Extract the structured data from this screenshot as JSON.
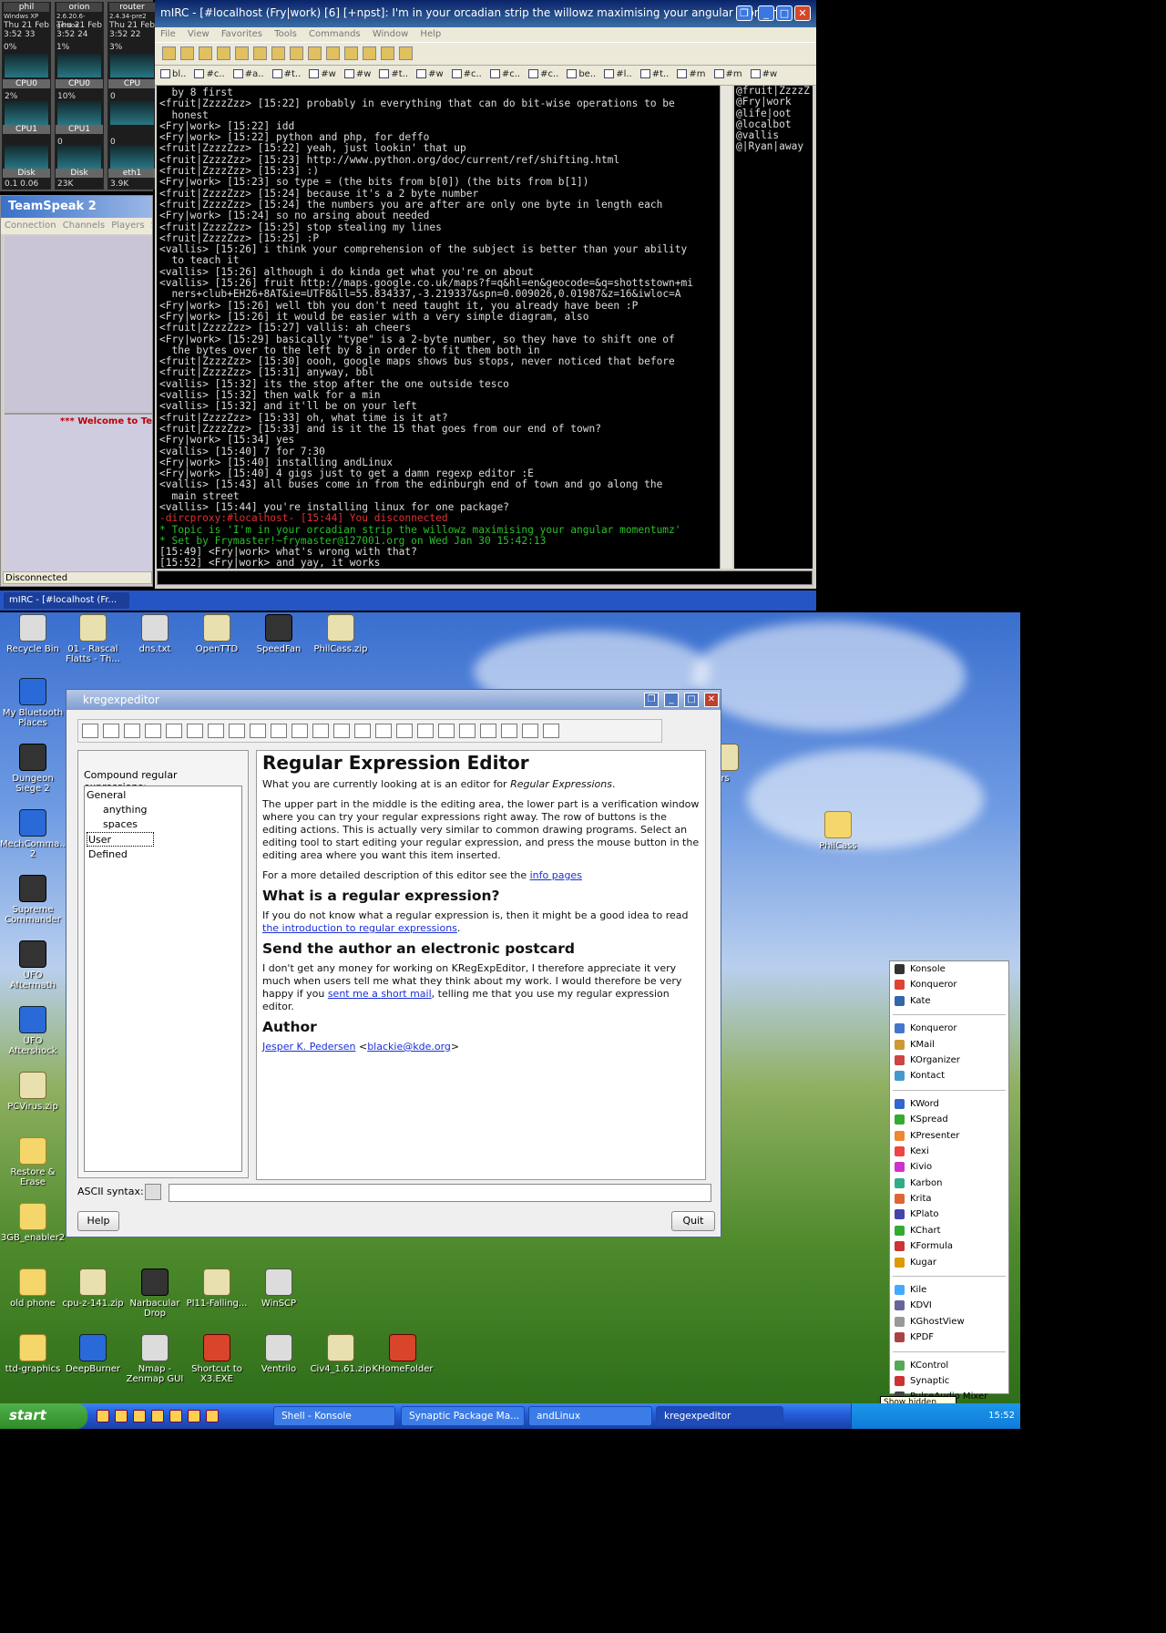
{
  "monitors": {
    "top": [
      {
        "host": "phil",
        "os": "Windws XP",
        "date": "Thu 21 Feb",
        "time": "3:52 33",
        "cpu_pct": "0%",
        "cpu_label": "CPU0",
        "cpu_pct2": "2%",
        "cpu1_label": "CPU1",
        "disk_label": "Disk",
        "disk_val": "0.1 0.06"
      },
      {
        "host": "orion",
        "os": "2.6.20.6-gentoo",
        "date": "Thu 21 Feb",
        "time": "3:52 24",
        "cpu_pct": "1%",
        "cpu_label": "CPU0",
        "cpu_pct2": "10%",
        "cpu1_label": "CPU1",
        "cpu1_val": "0",
        "disk_label": "Disk",
        "disk_val": "23K"
      },
      {
        "host": "router",
        "os": "2.4.34-pre2",
        "date": "Thu 21 Feb",
        "time": "3:52 22",
        "cpu_pct": "3%",
        "cpu_label": "CPU",
        "cpu_pct2": "0",
        "cpu1_label": "",
        "cpu1_val": "0",
        "disk_label": "eth1",
        "disk_val": "3.9K"
      }
    ]
  },
  "teamspeak": {
    "title": "TeamSpeak 2",
    "menu": [
      "Connection",
      "Channels",
      "Players",
      "Se"
    ],
    "welcome": "*** Welcome to Te",
    "status": "Disconnected"
  },
  "mirc": {
    "title": "mIRC - [#localhost (Fry|work) [6] [+npst]: I'm in your orcadian strip the willowz maximising your angular moment",
    "menu": [
      "File",
      "View",
      "Favorites",
      "Tools",
      "Commands",
      "Window",
      "Help"
    ],
    "tabs": [
      "bl..",
      "#c..",
      "#a..",
      "#t..",
      "#w",
      "#w",
      "#t..",
      "#w",
      "#c..",
      "#c..",
      "#c..",
      "be..",
      "#l..",
      "#t..",
      "#m",
      "#m",
      "#w"
    ],
    "chat": [
      {
        "t": "  by 8 first",
        "c": ""
      },
      {
        "t": "<fruit|ZzzzZzz> [15:22] probably in everything that can do bit-wise operations to be\n  honest",
        "c": ""
      },
      {
        "t": "<Fry|work> [15:22] idd",
        "c": ""
      },
      {
        "t": "<Fry|work> [15:22] python and php, for deffo",
        "c": ""
      },
      {
        "t": "<fruit|ZzzzZzz> [15:22] yeah, just lookin' that up",
        "c": ""
      },
      {
        "t": "<fruit|ZzzzZzz> [15:23] http://www.python.org/doc/current/ref/shifting.html",
        "c": ""
      },
      {
        "t": "<fruit|ZzzzZzz> [15:23] :)",
        "c": ""
      },
      {
        "t": "<Fry|work> [15:23] so type = (the bits from b[0]) (the bits from b[1])",
        "c": ""
      },
      {
        "t": "<fruit|ZzzzZzz> [15:24] because it's a 2 byte number",
        "c": ""
      },
      {
        "t": "<fruit|ZzzzZzz> [15:24] the numbers you are after are only one byte in length each",
        "c": ""
      },
      {
        "t": "<Fry|work> [15:24] so no arsing about needed",
        "c": ""
      },
      {
        "t": "<fruit|ZzzzZzz> [15:25] stop stealing my lines",
        "c": ""
      },
      {
        "t": "<fruit|ZzzzZzz> [15:25] :P",
        "c": ""
      },
      {
        "t": "<vallis> [15:26] i think your comprehension of the subject is better than your ability\n  to teach it",
        "c": ""
      },
      {
        "t": "<vallis> [15:26] although i do kinda get what you're on about",
        "c": ""
      },
      {
        "t": "<vallis> [15:26] fruit http://maps.google.co.uk/maps?f=q&hl=en&geocode=&q=shottstown+mi\n  ners+club+EH26+8AT&ie=UTF8&ll=55.834337,-3.219337&spn=0.009026,0.01987&z=16&iwloc=A",
        "c": ""
      },
      {
        "t": "<Fry|work> [15:26] well tbh you don't need taught it, you already have been :P",
        "c": ""
      },
      {
        "t": "<Fry|work> [15:26] it would be easier with a very simple diagram, also",
        "c": ""
      },
      {
        "t": "<fruit|ZzzzZzz> [15:27] vallis: ah cheers",
        "c": ""
      },
      {
        "t": "<Fry|work> [15:29] basically \"type\" is a 2-byte number, so they have to shift one of\n  the bytes over to the left by 8 in order to fit them both in",
        "c": ""
      },
      {
        "t": "<fruit|ZzzzZzz> [15:30] oooh, google maps shows bus stops, never noticed that before",
        "c": ""
      },
      {
        "t": "<fruit|ZzzzZzz> [15:31] anyway, bbl",
        "c": ""
      },
      {
        "t": "<vallis> [15:32] its the stop after the one outside tesco",
        "c": ""
      },
      {
        "t": "<vallis> [15:32] then walk for a min",
        "c": ""
      },
      {
        "t": "<vallis> [15:32] and it'll be on your left",
        "c": ""
      },
      {
        "t": "<fruit|ZzzzZzz> [15:33] oh, what time is it at?",
        "c": ""
      },
      {
        "t": "<fruit|ZzzzZzz> [15:33] and is it the 15 that goes from our end of town?",
        "c": ""
      },
      {
        "t": "<Fry|work> [15:34] yes",
        "c": ""
      },
      {
        "t": "<vallis> [15:40] 7 for 7:30",
        "c": ""
      },
      {
        "t": "<Fry|work> [15:40] installing andLinux",
        "c": ""
      },
      {
        "t": "<Fry|work> [15:40] 4 gigs just to get a damn regexp editor :E",
        "c": ""
      },
      {
        "t": "<vallis> [15:43] all buses come in from the edinburgh end of town and go along the\n  main street",
        "c": ""
      },
      {
        "t": "<vallis> [15:44] you're installing linux for one package?",
        "c": ""
      },
      {
        "t": "-dircproxy:#localhost- [15:44] You disconnected",
        "c": "red"
      },
      {
        "t": "* Topic is 'I'm in your orcadian strip the willowz maximising your angular momentumz'",
        "c": "green"
      },
      {
        "t": "* Set by Frymaster!~frymaster@127001.org on Wed Jan 30 15:42:13",
        "c": "green"
      },
      {
        "t": "[15:49] <Fry|work> what's wrong with that?",
        "c": ""
      },
      {
        "t": "[15:52] <Fry|work> and yay, it works",
        "c": ""
      }
    ],
    "nicks": [
      "@fruit|ZzzzZ",
      "@Fry|work",
      "@life|oot",
      "@localbot",
      "@vallis",
      "@|Ryan|away"
    ],
    "taskbar_item": "mIRC - [#localhost (Fr..."
  },
  "desktop_icons": [
    {
      "label": "Recycle Bin",
      "style": "gray"
    },
    {
      "label": "01 - Rascal Flatts - Th...",
      "style": ""
    },
    {
      "label": "dns.txt",
      "style": "gray"
    },
    {
      "label": "OpenTTD",
      "style": ""
    },
    {
      "label": "SpeedFan",
      "style": "dark"
    },
    {
      "label": "PhilCass.zip",
      "style": ""
    },
    {
      "label": "My Bluetooth Places",
      "style": "blue"
    },
    {
      "label": "Dungeon Siege 2",
      "style": "dark"
    },
    {
      "label": "MechComma... 2",
      "style": "blue"
    },
    {
      "label": "Supreme Commander",
      "style": "dark"
    },
    {
      "label": "UFO Aftermath",
      "style": "dark"
    },
    {
      "label": "UFO Aftershock",
      "style": "blue"
    },
    {
      "label": "PCVirus.zip",
      "style": ""
    },
    {
      "label": "Restore & Erase",
      "style": "folder"
    },
    {
      "label": "3GB_enabler2",
      "style": "folder"
    },
    {
      "label": "old phone",
      "style": "folder"
    },
    {
      "label": "cpu-z-141.zip",
      "style": ""
    },
    {
      "label": "Narbacular Drop",
      "style": "dark"
    },
    {
      "label": "PI11-Falling...",
      "style": ""
    },
    {
      "label": "WinSCP",
      "style": "gray"
    },
    {
      "label": "ttd-graphics",
      "style": "folder"
    },
    {
      "label": "DeepBurner",
      "style": "blue"
    },
    {
      "label": "Nmap - Zenmap GUI",
      "style": "gray"
    },
    {
      "label": "Shortcut to X3.EXE",
      "style": "red"
    },
    {
      "label": "Ventrilo",
      "style": "gray"
    },
    {
      "label": "Civ4_1.61.zip",
      "style": ""
    },
    {
      "label": "KHomeFolder",
      "style": "red"
    },
    {
      "label": "PhilCass",
      "style": "folder"
    },
    {
      "label": "rs",
      "style": ""
    }
  ],
  "kregexp": {
    "title": "kregexpeditor",
    "compound_label": "Compound regular expressions:",
    "tree": [
      "General",
      "anything",
      "spaces",
      "User Defined"
    ],
    "h1": "Regular Expression Editor",
    "p1_a": "What you are currently looking at is an editor for ",
    "p1_em": "Regular Expressions",
    "p1_b": ".",
    "p2": "The upper part in the middle is the editing area, the lower part is a verification window where you can try your regular expressions right away. The row of buttons is the editing actions. This is actually very similar to common drawing programs. Select an editing tool to start editing your regular expression, and press the mouse button in the editing area where you want this item inserted.",
    "p3_a": "For a more detailed description of this editor see the ",
    "p3_link": "info pages",
    "h2a": "What is a regular expression?",
    "p4_a": "If you do not know what a regular expression is, then it might be a good idea to read ",
    "p4_link": "the introduction to regular expressions",
    "p4_b": ".",
    "h2b": "Send the author an electronic postcard",
    "p5_a": "I don't get any money for working on KRegExpEditor, I therefore appreciate it very much when users tell me what they think about my work. I would therefore be very happy if you ",
    "p5_link": "sent me a short mail",
    "p5_b": ", telling me that you use my regular expression editor.",
    "h2c": "Author",
    "author_name": "Jesper K. Pedersen",
    "author_lt": " <",
    "author_email": "blackie@kde.org",
    "author_gt": ">",
    "ascii_label": "ASCII syntax:",
    "help_btn": "Help",
    "quit_btn": "Quit"
  },
  "kmenu": {
    "groups": [
      [
        {
          "n": "Konsole",
          "c": "#333"
        },
        {
          "n": "Konqueror",
          "c": "#d43"
        },
        {
          "n": "Kate",
          "c": "#36a"
        }
      ],
      [
        {
          "n": "Konqueror",
          "c": "#47c"
        },
        {
          "n": "KMail",
          "c": "#c93"
        },
        {
          "n": "KOrganizer",
          "c": "#c44"
        },
        {
          "n": "Kontact",
          "c": "#49c"
        }
      ],
      [
        {
          "n": "KWord",
          "c": "#36c"
        },
        {
          "n": "KSpread",
          "c": "#3a3"
        },
        {
          "n": "KPresenter",
          "c": "#e83"
        },
        {
          "n": "Kexi",
          "c": "#e44"
        },
        {
          "n": "Kivio",
          "c": "#c3c"
        },
        {
          "n": "Karbon",
          "c": "#3a8"
        },
        {
          "n": "Krita",
          "c": "#d63"
        },
        {
          "n": "KPlato",
          "c": "#44a"
        },
        {
          "n": "KChart",
          "c": "#3a3"
        },
        {
          "n": "KFormula",
          "c": "#c33"
        },
        {
          "n": "Kugar",
          "c": "#d90"
        }
      ],
      [
        {
          "n": "Kile",
          "c": "#4af"
        },
        {
          "n": "KDVI",
          "c": "#669"
        },
        {
          "n": "KGhostView",
          "c": "#999"
        },
        {
          "n": "KPDF",
          "c": "#a44"
        }
      ],
      [
        {
          "n": "KControl",
          "c": "#5a5"
        },
        {
          "n": "Synaptic",
          "c": "#c33"
        },
        {
          "n": "PulseAudio Mixer",
          "c": "#444"
        }
      ]
    ],
    "tooltip": "Show hidden icons"
  },
  "taskbar": {
    "start": "start",
    "tasks": [
      "Shell - Konsole",
      "Synaptic Package Ma...",
      "andLinux",
      "kregexpeditor"
    ],
    "clock": "15:52"
  }
}
